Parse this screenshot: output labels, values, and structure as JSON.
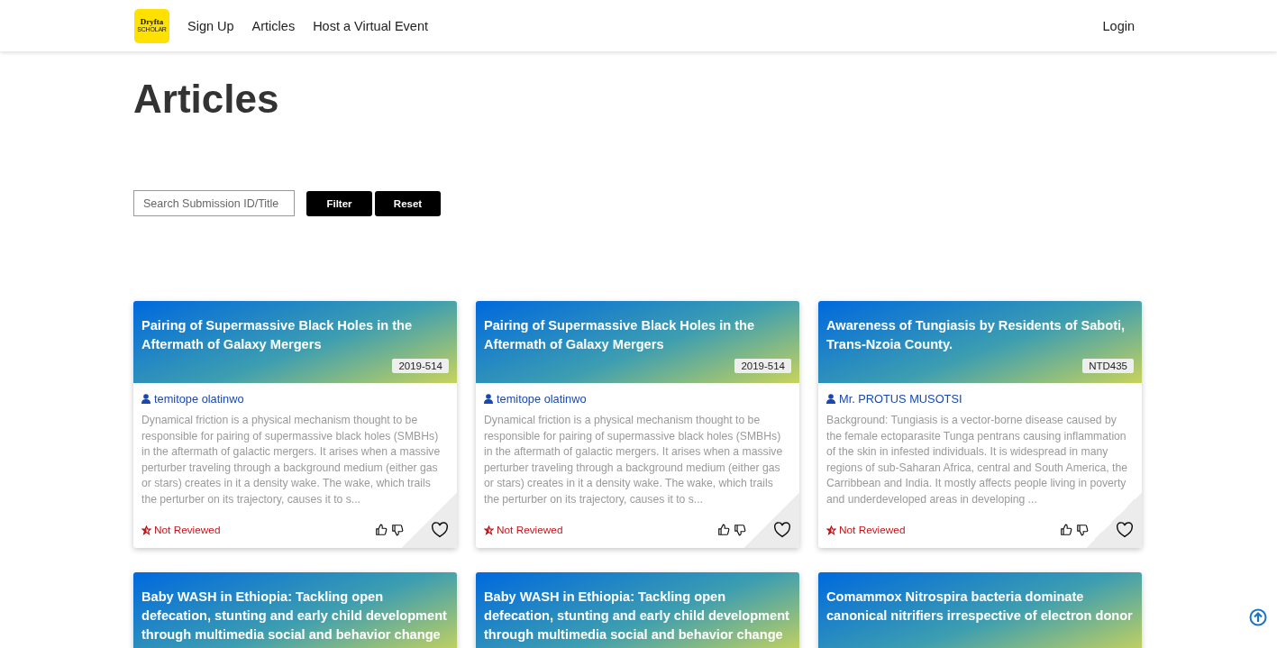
{
  "nav": {
    "logo": {
      "name": "Dryfta",
      "sub": "SCHOLAR"
    },
    "links": [
      "Sign Up",
      "Articles",
      "Host a Virtual Event"
    ],
    "login": "Login"
  },
  "page_title": "Articles",
  "search": {
    "placeholder": "Search Submission ID/Title"
  },
  "buttons": [
    "Filter",
    "Reset"
  ],
  "columns": [
    {
      "cards": [
        {
          "kind": "full",
          "title": "Pairing of Supermassive Black Holes in the Aftermath of Galaxy Mergers",
          "id": "2019-514",
          "author": "temitope olatinwo",
          "abstract": "Dynamical friction is a physical mechanism thought to be responsible for pairing of supermassive black holes (SMBHs) in the aftermath of galactic mergers. It arises when a massive perturber traveling through a background medium (either gas or stars) creates in it a density wake. The wake, which trails the perturber on its trajectory, causes it to s...",
          "status": "Not Reviewed"
        },
        {
          "kind": "partial",
          "title": "Baby WASH in Ethiopia: Tackling open defecation, stunting and early child development through multimedia social and behavior change"
        }
      ]
    },
    {
      "cards": [
        {
          "kind": "full",
          "title": "Pairing of Supermassive Black Holes in the Aftermath of Galaxy Mergers",
          "id": "2019-514",
          "author": "temitope olatinwo",
          "abstract": "Dynamical friction is a physical mechanism thought to be responsible for pairing of supermassive black holes (SMBHs) in the aftermath of galactic mergers. It arises when a massive perturber traveling through a background medium (either gas or stars) creates in it a density wake. The wake, which trails the perturber on its trajectory, causes it to s...",
          "status": "Not Reviewed"
        },
        {
          "kind": "partial",
          "title": "Baby WASH in Ethiopia: Tackling open defecation, stunting and early child development through multimedia social and behavior change"
        }
      ]
    },
    {
      "cards": [
        {
          "kind": "full",
          "title": "Awareness of Tungiasis by Residents of Saboti, Trans-Nzoia County.",
          "id": "NTD435",
          "author": "Mr. PROTUS MUSOTSI",
          "abstract": "Background: Tungiasis is a vector-borne disease caused by the female ectoparasite Tunga pentrans causing inflammation of the skin in infested individuals. It is widespread in many regions of sub-Saharan Africa, central and South America, the Carribbean and India. It mostly affects people living in poverty and underdeveloped areas in developing ...",
          "status": "Not Reviewed"
        },
        {
          "kind": "partial",
          "title": "Comammox Nitrospira bacteria dominate canonical nitrifiers irrespective of electron donor"
        }
      ]
    }
  ]
}
